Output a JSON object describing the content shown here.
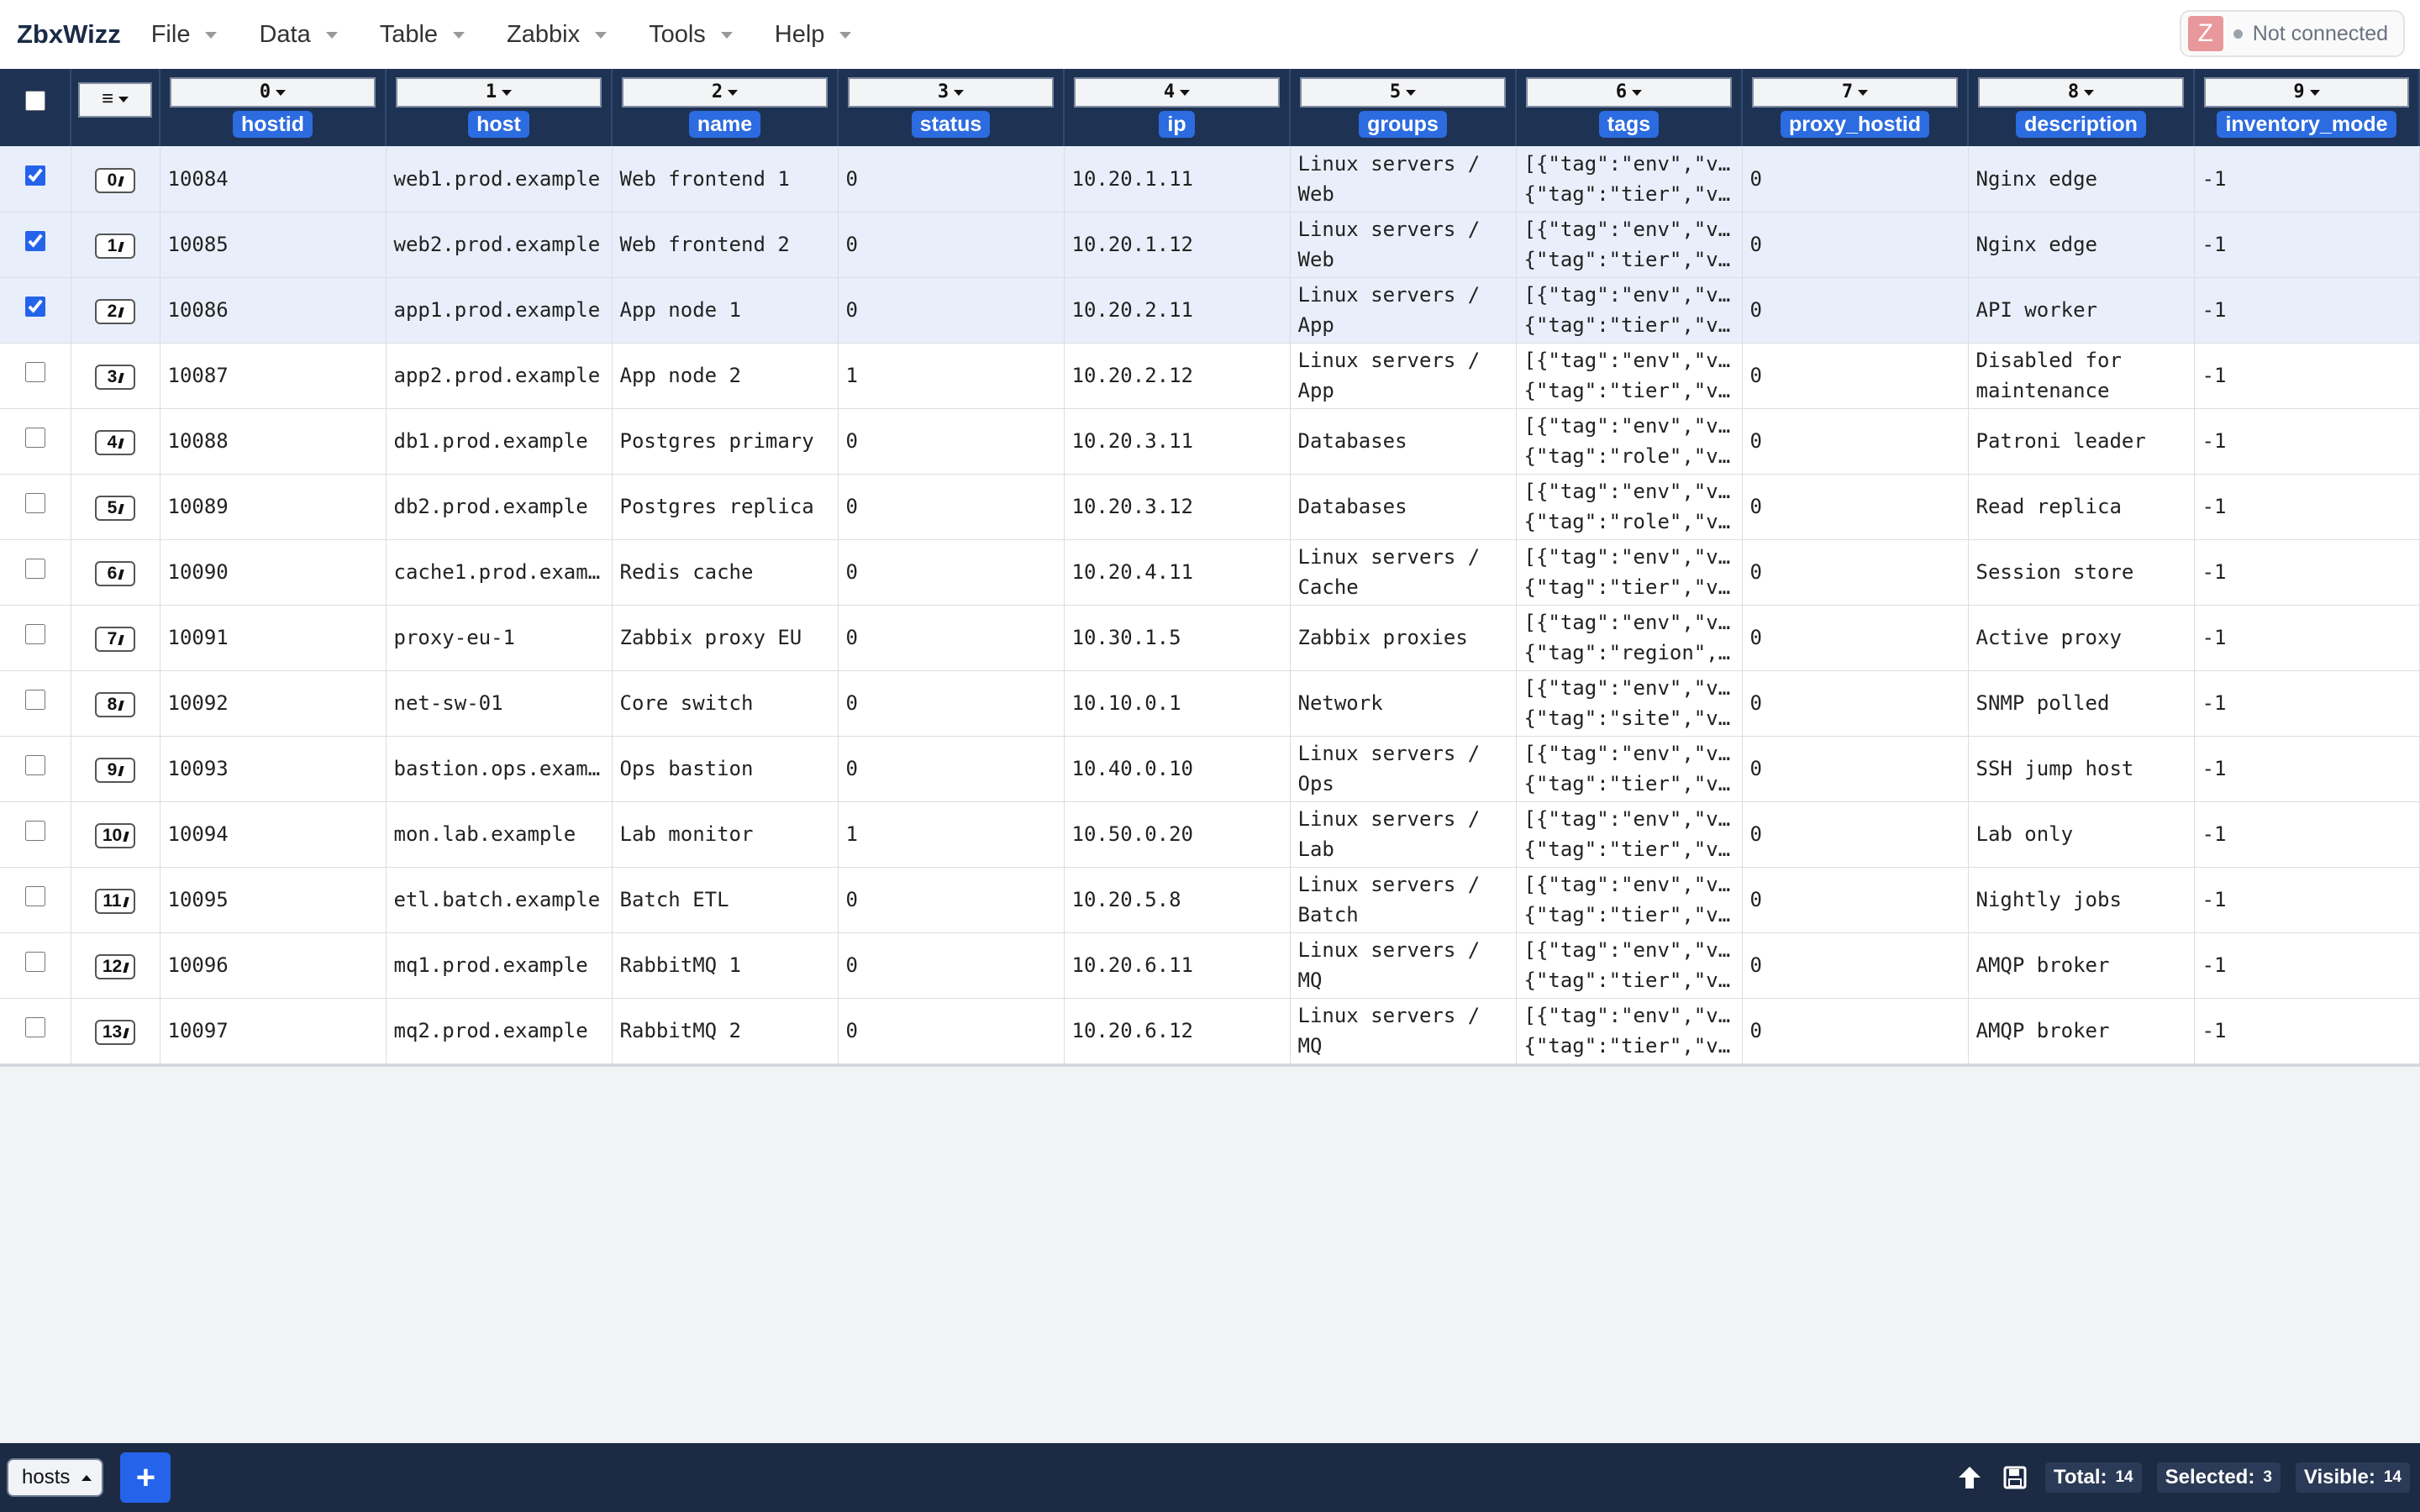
{
  "app": {
    "logo": "ZbxWizz"
  },
  "menu": [
    {
      "label": "File"
    },
    {
      "label": "Data"
    },
    {
      "label": "Table"
    },
    {
      "label": "Zabbix"
    },
    {
      "label": "Tools"
    },
    {
      "label": "Help"
    }
  ],
  "connection": {
    "badge": "Z",
    "status": "Not connected"
  },
  "columns": [
    {
      "index": "0",
      "name": "hostid"
    },
    {
      "index": "1",
      "name": "host"
    },
    {
      "index": "2",
      "name": "name"
    },
    {
      "index": "3",
      "name": "status"
    },
    {
      "index": "4",
      "name": "ip"
    },
    {
      "index": "5",
      "name": "groups"
    },
    {
      "index": "6",
      "name": "tags"
    },
    {
      "index": "7",
      "name": "proxy_hostid"
    },
    {
      "index": "8",
      "name": "description"
    },
    {
      "index": "9",
      "name": "inventory_mode"
    }
  ],
  "row_menu_label": "≡",
  "rows": [
    {
      "idx": "0",
      "selected": true,
      "cells": [
        "10084",
        "web1.prod.example",
        "Web frontend 1",
        "0",
        "10.20.1.11",
        "Linux servers / Web",
        "[{\"tag\":\"env\",\"v…\n{\"tag\":\"tier\",\"v…",
        "0",
        "Nginx edge",
        "-1"
      ]
    },
    {
      "idx": "1",
      "selected": true,
      "cells": [
        "10085",
        "web2.prod.example",
        "Web frontend 2",
        "0",
        "10.20.1.12",
        "Linux servers / Web",
        "[{\"tag\":\"env\",\"v…\n{\"tag\":\"tier\",\"v…",
        "0",
        "Nginx edge",
        "-1"
      ]
    },
    {
      "idx": "2",
      "selected": true,
      "cells": [
        "10086",
        "app1.prod.example",
        "App node 1",
        "0",
        "10.20.2.11",
        "Linux servers / App",
        "[{\"tag\":\"env\",\"v…\n{\"tag\":\"tier\",\"v…",
        "0",
        "API worker",
        "-1"
      ]
    },
    {
      "idx": "3",
      "selected": false,
      "cells": [
        "10087",
        "app2.prod.example",
        "App node 2",
        "1",
        "10.20.2.12",
        "Linux servers / App",
        "[{\"tag\":\"env\",\"v…\n{\"tag\":\"tier\",\"v…",
        "0",
        "Disabled for maintenance",
        "-1"
      ]
    },
    {
      "idx": "4",
      "selected": false,
      "cells": [
        "10088",
        "db1.prod.example",
        "Postgres primary",
        "0",
        "10.20.3.11",
        "Databases",
        "[{\"tag\":\"env\",\"v…\n{\"tag\":\"role\",\"v…",
        "0",
        "Patroni leader",
        "-1"
      ]
    },
    {
      "idx": "5",
      "selected": false,
      "cells": [
        "10089",
        "db2.prod.example",
        "Postgres replica",
        "0",
        "10.20.3.12",
        "Databases",
        "[{\"tag\":\"env\",\"v…\n{\"tag\":\"role\",\"v…",
        "0",
        "Read replica",
        "-1"
      ]
    },
    {
      "idx": "6",
      "selected": false,
      "cells": [
        "10090",
        "cache1.prod.exam…",
        "Redis cache",
        "0",
        "10.20.4.11",
        "Linux servers / Cache",
        "[{\"tag\":\"env\",\"v…\n{\"tag\":\"tier\",\"v…",
        "0",
        "Session store",
        "-1"
      ]
    },
    {
      "idx": "7",
      "selected": false,
      "cells": [
        "10091",
        "proxy-eu-1",
        "Zabbix proxy EU",
        "0",
        "10.30.1.5",
        "Zabbix proxies",
        "[{\"tag\":\"env\",\"v…\n{\"tag\":\"region\",…",
        "0",
        "Active proxy",
        "-1"
      ]
    },
    {
      "idx": "8",
      "selected": false,
      "cells": [
        "10092",
        "net-sw-01",
        "Core switch",
        "0",
        "10.10.0.1",
        "Network",
        "[{\"tag\":\"env\",\"v…\n{\"tag\":\"site\",\"v…",
        "0",
        "SNMP polled",
        "-1"
      ]
    },
    {
      "idx": "9",
      "selected": false,
      "cells": [
        "10093",
        "bastion.ops.exam…",
        "Ops bastion",
        "0",
        "10.40.0.10",
        "Linux servers / Ops",
        "[{\"tag\":\"env\",\"v…\n{\"tag\":\"tier\",\"v…",
        "0",
        "SSH jump host",
        "-1"
      ]
    },
    {
      "idx": "10",
      "selected": false,
      "cells": [
        "10094",
        "mon.lab.example",
        "Lab monitor",
        "1",
        "10.50.0.20",
        "Linux servers / Lab",
        "[{\"tag\":\"env\",\"v…\n{\"tag\":\"tier\",\"v…",
        "0",
        "Lab only",
        "-1"
      ]
    },
    {
      "idx": "11",
      "selected": false,
      "cells": [
        "10095",
        "etl.batch.example",
        "Batch ETL",
        "0",
        "10.20.5.8",
        "Linux servers / Batch",
        "[{\"tag\":\"env\",\"v…\n{\"tag\":\"tier\",\"v…",
        "0",
        "Nightly jobs",
        "-1"
      ]
    },
    {
      "idx": "12",
      "selected": false,
      "cells": [
        "10096",
        "mq1.prod.example",
        "RabbitMQ 1",
        "0",
        "10.20.6.11",
        "Linux servers / MQ",
        "[{\"tag\":\"env\",\"v…\n{\"tag\":\"tier\",\"v…",
        "0",
        "AMQP broker",
        "-1"
      ]
    },
    {
      "idx": "13",
      "selected": false,
      "cells": [
        "10097",
        "mq2.prod.example",
        "RabbitMQ 2",
        "0",
        "10.20.6.12",
        "Linux servers / MQ",
        "[{\"tag\":\"env\",\"v…\n{\"tag\":\"tier\",\"v…",
        "0",
        "AMQP broker",
        "-1"
      ]
    }
  ],
  "bottom": {
    "sheet_tab": "hosts",
    "add_label": "+",
    "total_label": "Total:",
    "total_value": "14",
    "selected_label": "Selected:",
    "selected_value": "3",
    "visible_label": "Visible:",
    "visible_value": "14"
  },
  "colors": {
    "header_bg": "#1e3253",
    "accent": "#2c6be0",
    "selected_row": "#e9effa",
    "bottom_bg": "#1c2a43"
  }
}
